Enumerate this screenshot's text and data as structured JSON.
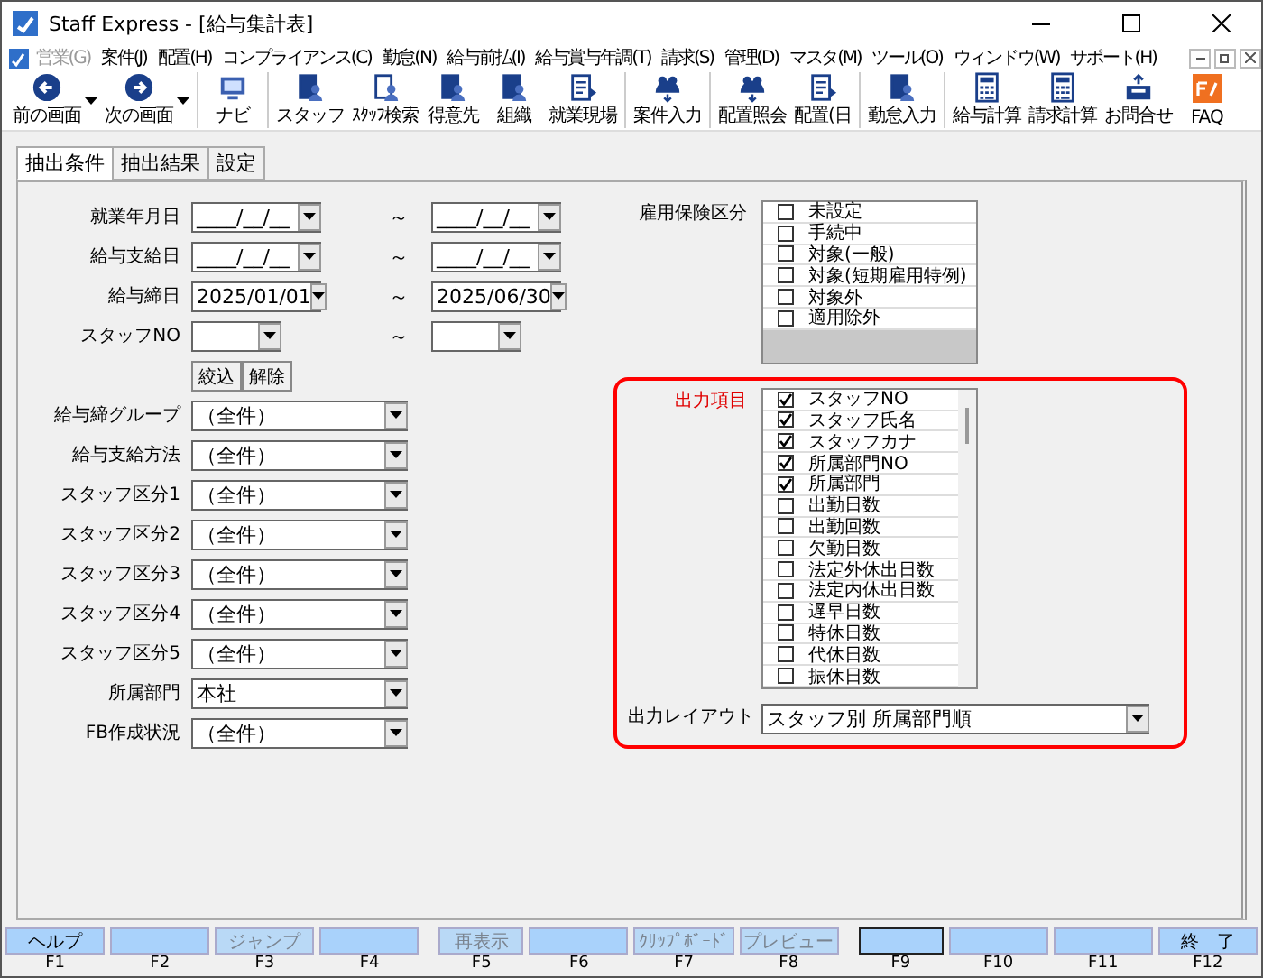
{
  "window": {
    "title": "Staff Express - [給与集計表]"
  },
  "menu": [
    {
      "label": "営業(G)",
      "disabled": true
    },
    {
      "label": "案件(J)",
      "disabled": false
    },
    {
      "label": "配置(H)",
      "disabled": false
    },
    {
      "label": "コンプライアンス(C)",
      "disabled": false
    },
    {
      "label": "勤怠(N)",
      "disabled": false
    },
    {
      "label": "給与前払(I)",
      "disabled": false
    },
    {
      "label": "給与賞与年調(T)",
      "disabled": false
    },
    {
      "label": "請求(S)",
      "disabled": false
    },
    {
      "label": "管理(D)",
      "disabled": false
    },
    {
      "label": "マスタ(M)",
      "disabled": false
    },
    {
      "label": "ツール(O)",
      "disabled": false
    },
    {
      "label": "ウィンドウ(W)",
      "disabled": false
    },
    {
      "label": "サポート(H)",
      "disabled": false
    }
  ],
  "toolbar": {
    "groups": [
      [
        {
          "label": "前の画面",
          "has_menu": true
        },
        {
          "label": "次の画面",
          "has_menu": true
        }
      ],
      [
        {
          "label": "ナビ",
          "has_menu": false
        }
      ],
      [
        {
          "label": "スタッフ",
          "has_menu": false
        },
        {
          "label": "ｽﾀｯﾌ検索",
          "has_menu": false
        },
        {
          "label": "得意先",
          "has_menu": false
        },
        {
          "label": "組織",
          "has_menu": false
        },
        {
          "label": "就業現場",
          "has_menu": false
        }
      ],
      [
        {
          "label": "案件入力",
          "has_menu": false
        }
      ],
      [
        {
          "label": "配置照会",
          "has_menu": false
        },
        {
          "label": "配置(日",
          "has_menu": false
        }
      ],
      [
        {
          "label": "勤怠入力",
          "has_menu": false
        }
      ],
      [
        {
          "label": "給与計算",
          "has_menu": false
        },
        {
          "label": "請求計算",
          "has_menu": false
        },
        {
          "label": "お問合せ",
          "has_menu": false
        },
        {
          "label": "FAQ",
          "has_menu": false
        }
      ]
    ]
  },
  "tabs": [
    {
      "label": "抽出条件",
      "selected": true
    },
    {
      "label": "抽出結果",
      "selected": false
    },
    {
      "label": "設定",
      "selected": false
    }
  ],
  "range_fields": [
    {
      "label": "就業年月日",
      "from": "____/__/__",
      "to": "____/__/__",
      "tilde": "～"
    },
    {
      "label": "給与支給日",
      "from": "____/__/__",
      "to": "____/__/__",
      "tilde": "～"
    },
    {
      "label": "給与締日",
      "from": "2025/01/01",
      "to": "2025/06/30",
      "tilde": "～"
    },
    {
      "label": "スタッフNO",
      "tilde": "～"
    }
  ],
  "filter_buttons": [
    "絞込",
    "解除"
  ],
  "select_fields": [
    {
      "label": "給与締グループ",
      "value": "（全件）"
    },
    {
      "label": "給与支給方法",
      "value": "（全件）"
    },
    {
      "label": "スタッフ区分1",
      "value": "（全件）"
    },
    {
      "label": "スタッフ区分2",
      "value": "（全件）"
    },
    {
      "label": "スタッフ区分3",
      "value": "（全件）"
    },
    {
      "label": "スタッフ区分4",
      "value": "（全件）"
    },
    {
      "label": "スタッフ区分5",
      "value": "（全件）"
    },
    {
      "label": "所属部門",
      "value": "本社"
    },
    {
      "label": "FB作成状況",
      "value": "（全件）"
    }
  ],
  "employment_insurance": {
    "label": "雇用保険区分",
    "items": [
      {
        "label": "未設定",
        "checked": false
      },
      {
        "label": "手続中",
        "checked": false
      },
      {
        "label": "対象(一般)",
        "checked": false
      },
      {
        "label": "対象(短期雇用特例)",
        "checked": false
      },
      {
        "label": "対象外",
        "checked": false
      },
      {
        "label": "適用除外",
        "checked": false
      }
    ]
  },
  "output_items": {
    "label": "出力項目",
    "items": [
      {
        "label": "スタッフNO",
        "checked": true
      },
      {
        "label": "スタッフ氏名",
        "checked": true
      },
      {
        "label": "スタッフカナ",
        "checked": true
      },
      {
        "label": "所属部門NO",
        "checked": true
      },
      {
        "label": "所属部門",
        "checked": true
      },
      {
        "label": "出勤日数",
        "checked": false
      },
      {
        "label": "出勤回数",
        "checked": false
      },
      {
        "label": "欠勤日数",
        "checked": false
      },
      {
        "label": "法定外休出日数",
        "checked": false
      },
      {
        "label": "法定内休出日数",
        "checked": false
      },
      {
        "label": "遅早日数",
        "checked": false
      },
      {
        "label": "特休日数",
        "checked": false
      },
      {
        "label": "代休日数",
        "checked": false
      },
      {
        "label": "振休日数",
        "checked": false
      }
    ]
  },
  "output_layout": {
    "label": "出力レイアウト",
    "value": "スタッフ別 所属部門順"
  },
  "function_keys": [
    {
      "key": "F1",
      "label": "ヘルプ",
      "disabled": false,
      "focused": false
    },
    {
      "key": "F2",
      "disabled": false,
      "focused": false
    },
    {
      "key": "F3",
      "label": "ジャンプ",
      "disabled": true,
      "focused": false
    },
    {
      "key": "F4",
      "disabled": false,
      "focused": false
    },
    {
      "key": "F5",
      "label": "再表示",
      "disabled": true,
      "focused": false
    },
    {
      "key": "F6",
      "disabled": false,
      "focused": false
    },
    {
      "key": "F7",
      "label": "ｸﾘｯﾌﾟﾎﾞｰﾄﾞ",
      "disabled": true,
      "focused": false
    },
    {
      "key": "F8",
      "label": "プレビュー",
      "disabled": true,
      "focused": false
    },
    {
      "key": "F9",
      "disabled": false,
      "focused": true
    },
    {
      "key": "F10",
      "disabled": false,
      "focused": false
    },
    {
      "key": "F11",
      "disabled": false,
      "focused": false
    },
    {
      "key": "F12",
      "label": "終　了",
      "disabled": false,
      "focused": false
    }
  ]
}
